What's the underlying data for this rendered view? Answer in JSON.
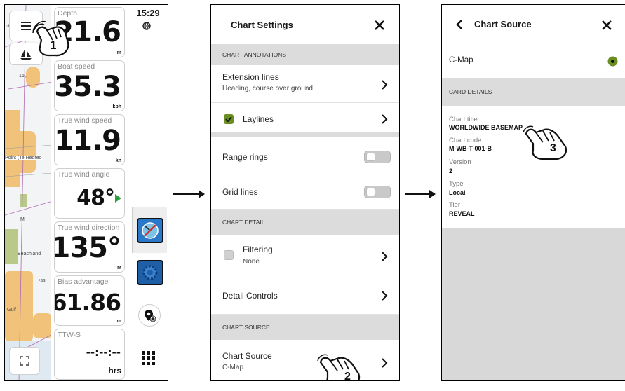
{
  "panel1": {
    "clock": "15:29",
    "map_labels": [
      "nt",
      "16₅",
      "Point (Te Reoreo",
      "M",
      "Beachland",
      "•ss",
      "Gulf"
    ],
    "tiles": [
      {
        "label": "Depth",
        "value": "21.6",
        "unit": "m"
      },
      {
        "label": "Boat speed",
        "value": "35.3",
        "unit": "kph"
      },
      {
        "label": "True wind speed",
        "value": "11.9",
        "unit": "kn"
      },
      {
        "label": "True wind angle",
        "value": "48°",
        "unit": ""
      },
      {
        "label": "True wind direction",
        "value": "135°",
        "unit": "M"
      },
      {
        "label": "Bias advantage",
        "value": "61.86",
        "unit": "m"
      },
      {
        "label": "TTW-S",
        "value": "--:--:--",
        "unit": "hrs"
      }
    ],
    "callout": "1"
  },
  "panel2": {
    "title": "Chart Settings",
    "sections": {
      "annotations": "CHART ANNOTATIONS",
      "detail": "CHART DETAIL",
      "source": "CHART SOURCE"
    },
    "rows": {
      "extension_title": "Extension lines",
      "extension_sub": "Heading, course over ground",
      "laylines": "Laylines",
      "range_rings": "Range rings",
      "grid_lines": "Grid lines",
      "filtering_title": "Filtering",
      "filtering_sub": "None",
      "detail_controls": "Detail Controls",
      "chart_source_title": "Chart Source",
      "chart_source_sub": "C-Map"
    },
    "callout": "2",
    "colors": {
      "check": "#6b8e23",
      "section_bg": "#dcdcdc"
    }
  },
  "panel3": {
    "title": "Chart Source",
    "source_option": "C-Map",
    "section": "CARD DETAILS",
    "details": [
      {
        "key": "Chart title",
        "value": "WORLDWIDE BASEMAP"
      },
      {
        "key": "Chart code",
        "value": "M-WB-T-001-B"
      },
      {
        "key": "Version",
        "value": "2"
      },
      {
        "key": "Type",
        "value": "Local"
      },
      {
        "key": "Tier",
        "value": "REVEAL"
      }
    ],
    "callout": "3",
    "colors": {
      "radio": "#6b8e23"
    }
  }
}
